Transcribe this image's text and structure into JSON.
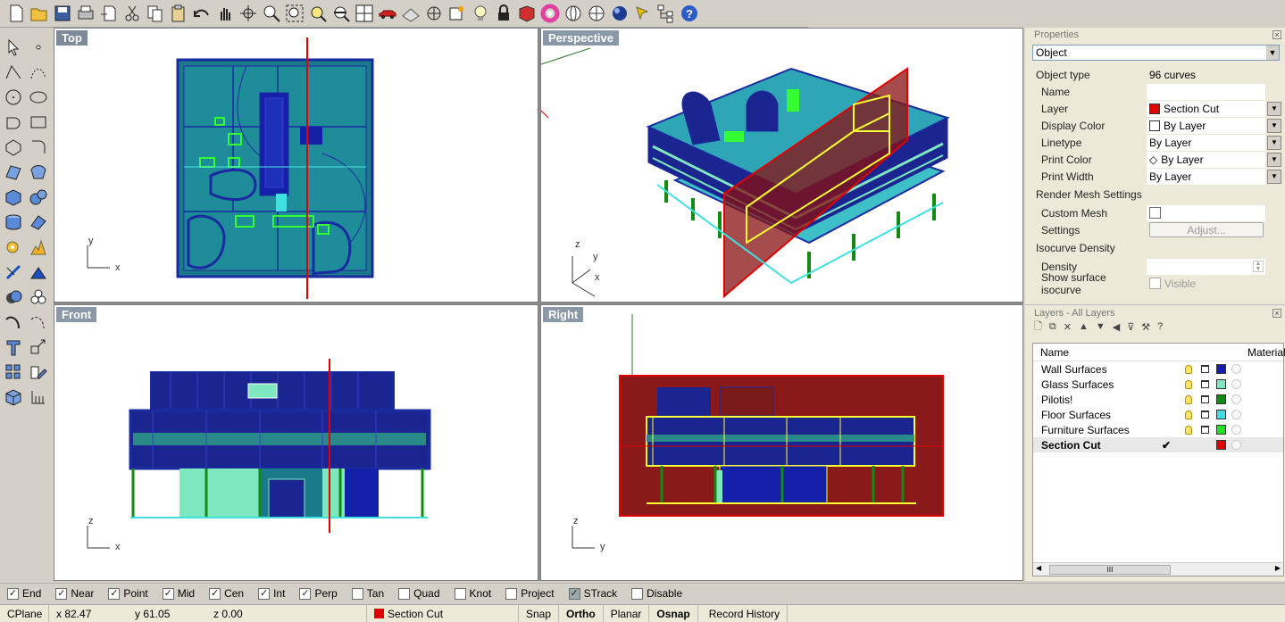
{
  "toolbar": {
    "icons": [
      "new-icon",
      "open-icon",
      "save-icon",
      "print-icon",
      "import-icon",
      "cut-icon",
      "copy-icon",
      "paste-icon",
      "undo-icon",
      "pan-icon",
      "rotate-icon",
      "zoom-icon",
      "zoom-window-icon",
      "zoom-selected-icon",
      "zoom-extents-icon",
      "four-viewports-icon",
      "car-icon",
      "grid-icon",
      "snap-icon",
      "layer-icon",
      "bulb-icon",
      "lock-icon",
      "render-icon",
      "color-wheel-icon",
      "sphere-icon",
      "globe-icon",
      "shaded-sphere-icon",
      "light-icon",
      "tree-icon",
      "help-icon"
    ]
  },
  "viewports": {
    "top": {
      "title": "Top",
      "axis_x": "x",
      "axis_y": "y"
    },
    "perspective": {
      "title": "Perspective",
      "axis_x": "x",
      "axis_y": "y",
      "axis_z": "z"
    },
    "front": {
      "title": "Front",
      "axis_x": "x",
      "axis_z": "z"
    },
    "right": {
      "title": "Right",
      "axis_y": "y",
      "axis_z": "z"
    }
  },
  "properties": {
    "panel_title": "Properties",
    "selector": "Object",
    "object_type_label": "Object type",
    "object_type_value": "96 curves",
    "name_label": "Name",
    "name_value": "",
    "layer_label": "Layer",
    "layer_value": "Section Cut",
    "display_color_label": "Display Color",
    "display_color_value": "By Layer",
    "linetype_label": "Linetype",
    "linetype_value": "By Layer",
    "print_color_label": "Print Color",
    "print_color_value": "By Layer",
    "print_width_label": "Print Width",
    "print_width_value": "By Layer",
    "render_mesh_label": "Render Mesh Settings",
    "custom_mesh_label": "Custom Mesh",
    "settings_label": "Settings",
    "adjust_button": "Adjust...",
    "isocurve_label": "Isocurve Density",
    "density_label": "Density",
    "show_iso_label": "Show surface isocurve",
    "visible_label": "Visible"
  },
  "layers": {
    "panel_title": "Layers - All Layers",
    "col_name": "Name",
    "col_material": "Material",
    "items": [
      {
        "name": "Wall Surfaces",
        "color": "#1a1ab0",
        "current": false
      },
      {
        "name": "Glass Surfaces",
        "color": "#7fe8c0",
        "current": false
      },
      {
        "name": "Pilotis!",
        "color": "#138a13",
        "current": false
      },
      {
        "name": "Floor Surfaces",
        "color": "#3de0e0",
        "current": false
      },
      {
        "name": "Furniture Surfaces",
        "color": "#22e022",
        "current": false
      },
      {
        "name": "Section Cut",
        "color": "#e00000",
        "current": true
      }
    ],
    "scroll_label": "III"
  },
  "osnap": [
    {
      "label": "End",
      "checked": true
    },
    {
      "label": "Near",
      "checked": true
    },
    {
      "label": "Point",
      "checked": true
    },
    {
      "label": "Mid",
      "checked": true
    },
    {
      "label": "Cen",
      "checked": true
    },
    {
      "label": "Int",
      "checked": true
    },
    {
      "label": "Perp",
      "checked": true
    },
    {
      "label": "Tan",
      "checked": false
    },
    {
      "label": "Quad",
      "checked": false
    },
    {
      "label": "Knot",
      "checked": false
    },
    {
      "label": "Project",
      "checked": false
    },
    {
      "label": "STrack",
      "checked": true
    },
    {
      "label": "Disable",
      "checked": false
    }
  ],
  "status": {
    "cplane": "CPlane",
    "x": "x 82.47",
    "y": "y 61.05",
    "z": "z 0.00",
    "layer": "Section Cut",
    "layer_color": "#e00000",
    "snap": "Snap",
    "ortho": "Ortho",
    "planar": "Planar",
    "osnap": "Osnap",
    "record_history": "Record History"
  }
}
